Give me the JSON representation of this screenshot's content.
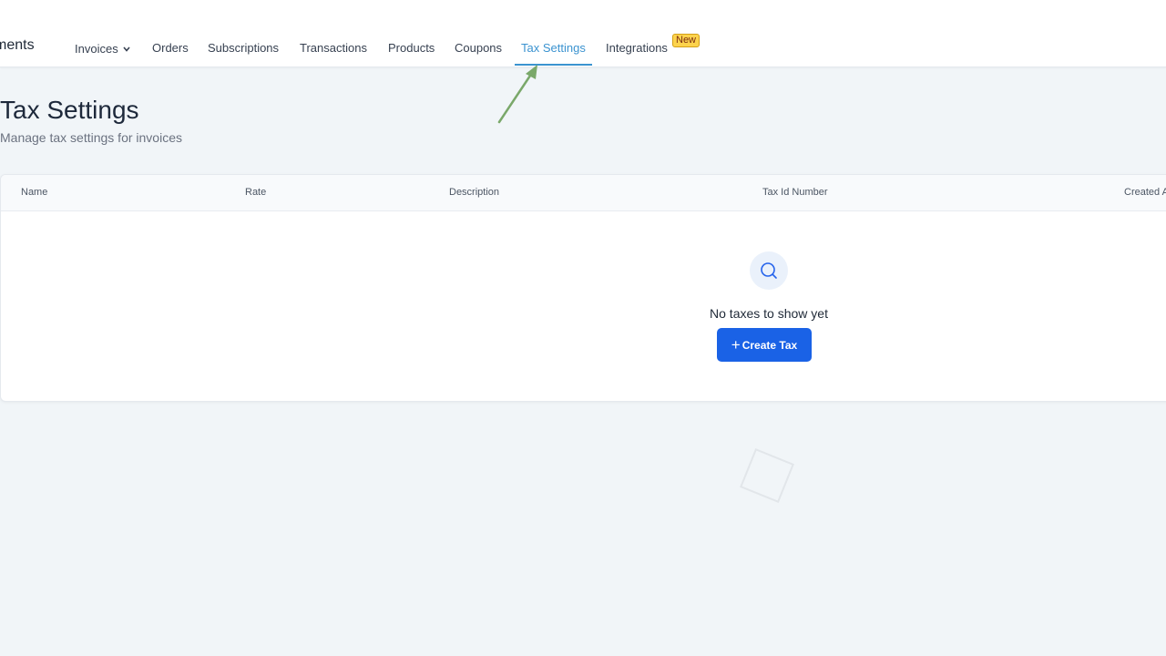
{
  "nav": {
    "brand": "yments",
    "items": [
      {
        "label": "Invoices"
      },
      {
        "label": "Orders"
      },
      {
        "label": "Subscriptions"
      },
      {
        "label": "Transactions"
      },
      {
        "label": "Products"
      },
      {
        "label": "Coupons"
      },
      {
        "label": "Tax Settings"
      },
      {
        "label": "Integrations"
      }
    ],
    "active": "Tax Settings",
    "new_badge": "New"
  },
  "page": {
    "title": "Tax Settings",
    "subtitle": "Manage tax settings for invoices"
  },
  "table": {
    "columns": [
      "Name",
      "Rate",
      "Description",
      "Tax Id Number",
      "Created At"
    ],
    "empty_text": "No taxes to show yet",
    "create_label": "Create Tax"
  },
  "icons": [
    "chevron-down-icon",
    "search-icon",
    "plus-icon"
  ],
  "colors": {
    "accent": "#3b93d0",
    "primary_button": "#1a62e6",
    "badge": "#fcd34d",
    "arrow": "#7aa86a",
    "background": "#f1f5f8"
  }
}
